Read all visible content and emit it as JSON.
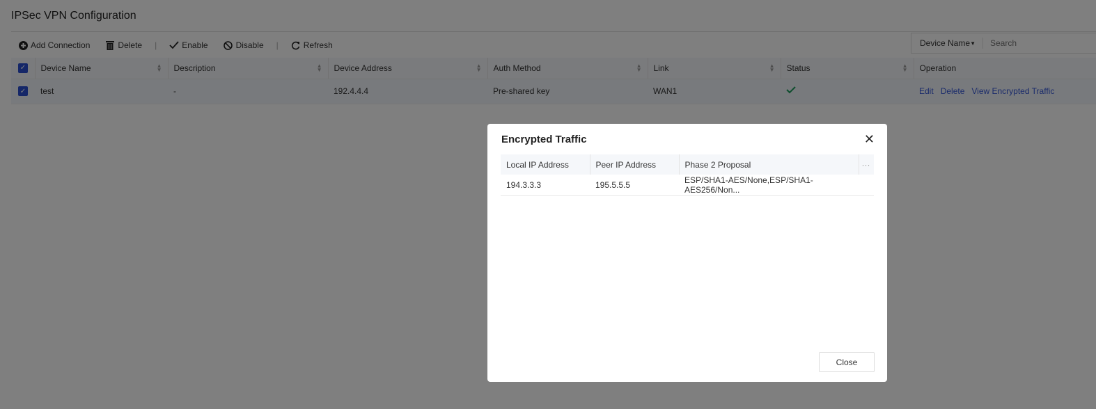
{
  "page": {
    "title": "IPSec VPN Configuration"
  },
  "toolbar": {
    "add": "Add Connection",
    "delete": "Delete",
    "enable": "Enable",
    "disable": "Disable",
    "refresh": "Refresh"
  },
  "search": {
    "field": "Device Name",
    "placeholder": "Search"
  },
  "table": {
    "headers": [
      "Device Name",
      "Description",
      "Device Address",
      "Auth Method",
      "Link",
      "Status",
      "Operation"
    ],
    "rows": [
      {
        "name": "test",
        "description": "-",
        "address": "192.4.4.4",
        "auth": "Pre-shared key",
        "link": "WAN1",
        "status": "enabled",
        "ops": [
          "Edit",
          "Delete",
          "View Encrypted Traffic"
        ]
      }
    ]
  },
  "colors": {
    "accent": "#2a4fd0",
    "status_ok": "#1a9a5a"
  },
  "modal": {
    "title": "Encrypted Traffic",
    "headers": [
      "Local IP Address",
      "Peer IP Address",
      "Phase 2 Proposal"
    ],
    "rows": [
      {
        "local": "194.3.3.3",
        "peer": "195.5.5.5",
        "proposal": "ESP/SHA1-AES/None,ESP/SHA1-AES256/Non..."
      }
    ],
    "close": "Close"
  }
}
